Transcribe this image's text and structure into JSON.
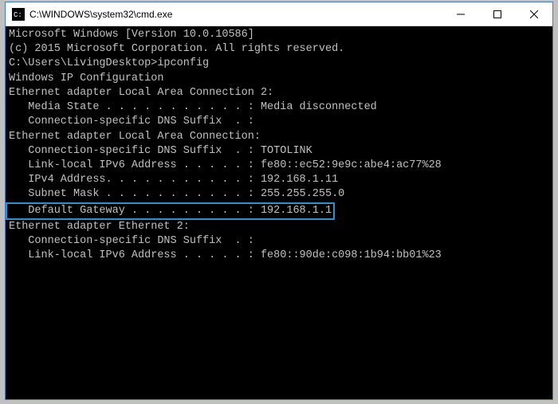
{
  "window": {
    "title": "C:\\WINDOWS\\system32\\cmd.exe",
    "icon": "cmd-icon"
  },
  "controls": {
    "minimize": "─",
    "maximize": "☐",
    "close": "✕"
  },
  "terminal": {
    "lines": {
      "l1": "Microsoft Windows [Version 10.0.10586]",
      "l2": "(c) 2015 Microsoft Corporation. All rights reserved.",
      "l3": "",
      "l4": "C:\\Users\\LivingDesktop>ipconfig",
      "l5": "",
      "l6": "Windows IP Configuration",
      "l7": "",
      "l8": "",
      "l9": "Ethernet adapter Local Area Connection 2:",
      "l10": "",
      "l11": "   Media State . . . . . . . . . . . : Media disconnected",
      "l12": "   Connection-specific DNS Suffix  . :",
      "l13": "",
      "l14": "Ethernet adapter Local Area Connection:",
      "l15": "",
      "l16": "   Connection-specific DNS Suffix  . : TOTOLINK",
      "l17": "   Link-local IPv6 Address . . . . . : fe80::ec52:9e9c:abe4:ac77%28",
      "l18": "   IPv4 Address. . . . . . . . . . . : 192.168.1.11",
      "l19": "   Subnet Mask . . . . . . . . . . . : 255.255.255.0",
      "l20": "   Default Gateway . . . . . . . . . : 192.168.1.1",
      "l21": "",
      "l22": "Ethernet adapter Ethernet 2:",
      "l23": "",
      "l24": "   Connection-specific DNS Suffix  . :",
      "l25": "   Link-local IPv6 Address . . . . . : fe80::90de:c098:1b94:bb01%23"
    }
  }
}
